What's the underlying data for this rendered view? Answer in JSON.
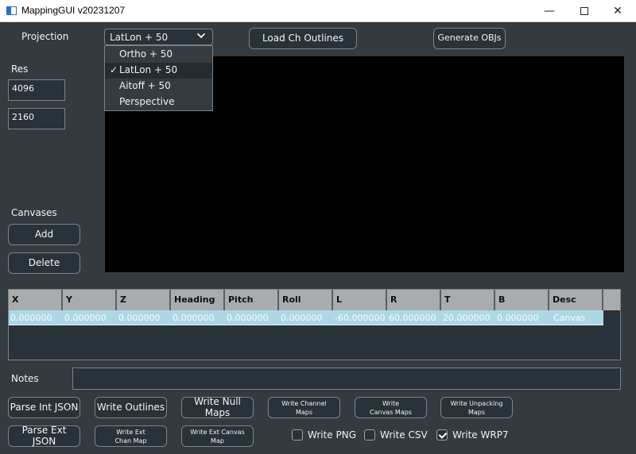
{
  "window": {
    "title": "MappingGUI v20231207",
    "controls": {
      "minimize": "—",
      "close": "✕"
    }
  },
  "projection": {
    "label": "Projection",
    "selected": "LatLon + 50",
    "options": [
      {
        "label": "Ortho + 50",
        "checked": false
      },
      {
        "label": "LatLon + 50",
        "checked": true
      },
      {
        "label": "Aitoff + 50",
        "checked": false
      },
      {
        "label": "Perspective",
        "checked": false
      }
    ],
    "check_glyph": "✓"
  },
  "toolbar": {
    "load_outlines": "Load Ch Outlines",
    "generate_objs": "Generate OBJs"
  },
  "resolution": {
    "label": "Res",
    "width": "4096",
    "height": "2160"
  },
  "canvases": {
    "label": "Canvases",
    "add": "Add",
    "delete": "Delete"
  },
  "table": {
    "columns": [
      "X",
      "Y",
      "Z",
      "Heading",
      "Pitch",
      "Roll",
      "L",
      "R",
      "T",
      "B",
      "Desc"
    ],
    "rows": [
      [
        "0.000000",
        "0.000000",
        "0.000000",
        "0.000000",
        "0.000000",
        "0.000000",
        "-60.000000",
        "60.000000",
        "20.000000",
        "0.000000",
        "Canvas"
      ]
    ]
  },
  "notes": {
    "label": "Notes",
    "value": ""
  },
  "actions": {
    "parse_int_json": "Parse Int JSON",
    "write_outlines": "Write Outlines",
    "write_null_maps": "Write Null Maps",
    "write_channel_maps": "Write Channel Maps",
    "write_canvas_maps": "Write Canvas Maps",
    "write_unpacking_maps": "Write Unpacking Maps",
    "parse_ext_json": "Parse Ext JSON",
    "write_ext_chan_map": "Write Ext Chan Map",
    "write_ext_canvas_map": "Write Ext Canvas Map"
  },
  "options": {
    "write_png": {
      "label": "Write PNG",
      "checked": false
    },
    "write_csv": {
      "label": "Write CSV",
      "checked": false
    },
    "write_wrp7": {
      "label": "Write WRP7",
      "checked": true
    }
  }
}
